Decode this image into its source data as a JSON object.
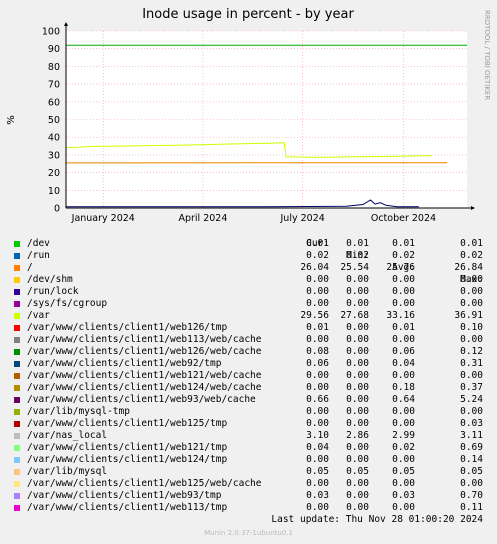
{
  "header": {
    "title": "Inode usage in percent - by year",
    "side_label": "RRDTOOL / TOBI OETIKER"
  },
  "chart_data": {
    "type": "line",
    "title": "Inode usage in percent - by year",
    "ylabel": "%",
    "ylim": [
      0,
      100
    ],
    "yticks": [
      0,
      10,
      20,
      30,
      40,
      50,
      60,
      70,
      80,
      90,
      100
    ],
    "xlim": [
      "2023-11-28",
      "2024-11-28"
    ],
    "xticks": [
      {
        "date": "2024-01-01",
        "label": "January 2024"
      },
      {
        "date": "2024-04-01",
        "label": "April 2024"
      },
      {
        "date": "2024-07-01",
        "label": "July 2024"
      },
      {
        "date": "2024-10-01",
        "label": "October 2024"
      }
    ],
    "grid": true,
    "series": [
      {
        "name": "/",
        "color": "#e88000",
        "points": [
          [
            "2023-11-28",
            25.5
          ],
          [
            "2024-11-10",
            25.6
          ]
        ]
      },
      {
        "name": "/var/nas_local",
        "color": "#00aa00",
        "points": [
          [
            "2023-11-28",
            92
          ],
          [
            "2024-11-28",
            92
          ]
        ]
      },
      {
        "name": "/var",
        "color": "#ccff00",
        "points": [
          [
            "2023-11-28",
            34.2
          ],
          [
            "2023-12-10",
            34.3
          ],
          [
            "2023-12-20",
            34.8
          ],
          [
            "2024-01-15",
            35.0
          ],
          [
            "2024-02-15",
            35.3
          ],
          [
            "2024-03-10",
            35.5
          ],
          [
            "2024-04-01",
            35.8
          ],
          [
            "2024-05-01",
            36.2
          ],
          [
            "2024-06-01",
            36.6
          ],
          [
            "2024-06-14",
            36.9
          ],
          [
            "2024-06-16",
            29.0
          ],
          [
            "2024-07-15",
            28.6
          ],
          [
            "2024-08-15",
            28.9
          ],
          [
            "2024-09-15",
            29.1
          ],
          [
            "2024-10-20",
            29.5
          ],
          [
            "2024-10-27",
            29.6
          ]
        ]
      },
      {
        "name": "/var/www/clients/client1/web93/web/cache",
        "color": "#000066",
        "points": [
          [
            "2023-11-28",
            0.7
          ],
          [
            "2024-06-01",
            0.7
          ],
          [
            "2024-08-10",
            1.0
          ],
          [
            "2024-08-25",
            2.0
          ],
          [
            "2024-09-01",
            4.5
          ],
          [
            "2024-09-05",
            2.2
          ],
          [
            "2024-09-10",
            3.0
          ],
          [
            "2024-09-15",
            1.5
          ],
          [
            "2024-09-25",
            0.7
          ],
          [
            "2024-10-15",
            0.7
          ]
        ]
      }
    ]
  },
  "legend": {
    "headers": {
      "cur": "Cur:",
      "min": "Min:",
      "avg": "Avg:",
      "max": "Max:"
    },
    "rows": [
      {
        "name": "/dev",
        "color": "#00cc00",
        "cur": "0.01",
        "min": "0.01",
        "avg": "0.01",
        "max": "0.01"
      },
      {
        "name": "/run",
        "color": "#0066b3",
        "cur": "0.02",
        "min": "0.02",
        "avg": "0.02",
        "max": "0.02"
      },
      {
        "name": "/",
        "color": "#ff8000",
        "cur": "26.04",
        "min": "25.54",
        "avg": "25.76",
        "max": "26.84"
      },
      {
        "name": "/dev/shm",
        "color": "#ffcc00",
        "cur": "0.00",
        "min": "0.00",
        "avg": "0.00",
        "max": "0.00"
      },
      {
        "name": "/run/lock",
        "color": "#330099",
        "cur": "0.00",
        "min": "0.00",
        "avg": "0.00",
        "max": "0.00"
      },
      {
        "name": "/sys/fs/cgroup",
        "color": "#990099",
        "cur": "0.00",
        "min": "0.00",
        "avg": "0.00",
        "max": "0.00"
      },
      {
        "name": "/var",
        "color": "#ccff00",
        "cur": "29.56",
        "min": "27.68",
        "avg": "33.16",
        "max": "36.91"
      },
      {
        "name": "/var/www/clients/client1/web126/tmp",
        "color": "#ff0000",
        "cur": "0.01",
        "min": "0.00",
        "avg": "0.01",
        "max": "0.10"
      },
      {
        "name": "/var/www/clients/client1/web113/web/cache",
        "color": "#808080",
        "cur": "0.00",
        "min": "0.00",
        "avg": "0.00",
        "max": "0.00"
      },
      {
        "name": "/var/www/clients/client1/web126/web/cache",
        "color": "#008f00",
        "cur": "0.08",
        "min": "0.00",
        "avg": "0.06",
        "max": "0.12"
      },
      {
        "name": "/var/www/clients/client1/web92/tmp",
        "color": "#00487d",
        "cur": "0.06",
        "min": "0.00",
        "avg": "0.04",
        "max": "0.31"
      },
      {
        "name": "/var/www/clients/client1/web121/web/cache",
        "color": "#b35a00",
        "cur": "0.00",
        "min": "0.00",
        "avg": "0.00",
        "max": "0.00"
      },
      {
        "name": "/var/www/clients/client1/web124/web/cache",
        "color": "#b38f00",
        "cur": "0.00",
        "min": "0.00",
        "avg": "0.18",
        "max": "0.37"
      },
      {
        "name": "/var/www/clients/client1/web93/web/cache",
        "color": "#6b006b",
        "cur": "0.66",
        "min": "0.00",
        "avg": "0.64",
        "max": "5.24"
      },
      {
        "name": "/var/lib/mysql-tmp",
        "color": "#8fb300",
        "cur": "0.00",
        "min": "0.00",
        "avg": "0.00",
        "max": "0.00"
      },
      {
        "name": "/var/www/clients/client1/web125/tmp",
        "color": "#b30000",
        "cur": "0.00",
        "min": "0.00",
        "avg": "0.00",
        "max": "0.03"
      },
      {
        "name": "/var/nas_local",
        "color": "#bebebe",
        "cur": "3.10",
        "min": "2.86",
        "avg": "2.99",
        "max": "3.11"
      },
      {
        "name": "/var/www/clients/client1/web121/tmp",
        "color": "#80ff80",
        "cur": "0.04",
        "min": "0.00",
        "avg": "0.02",
        "max": "0.69"
      },
      {
        "name": "/var/www/clients/client1/web124/tmp",
        "color": "#80c9ff",
        "cur": "0.00",
        "min": "0.00",
        "avg": "0.00",
        "max": "0.14"
      },
      {
        "name": "/var/lib/mysql",
        "color": "#ffc080",
        "cur": "0.05",
        "min": "0.05",
        "avg": "0.05",
        "max": "0.05"
      },
      {
        "name": "/var/www/clients/client1/web125/web/cache",
        "color": "#ffe680",
        "cur": "0.00",
        "min": "0.00",
        "avg": "0.00",
        "max": "0.00"
      },
      {
        "name": "/var/www/clients/client1/web93/tmp",
        "color": "#aa80ff",
        "cur": "0.03",
        "min": "0.00",
        "avg": "0.03",
        "max": "0.70"
      },
      {
        "name": "/var/www/clients/client1/web113/tmp",
        "color": "#ee00cc",
        "cur": "0.00",
        "min": "0.00",
        "avg": "0.00",
        "max": "0.11"
      }
    ]
  },
  "footer": {
    "last_update": "Last update: Thu Nov 28 01:00:20 2024",
    "munin": "Munin 2.0.37-1ubuntu0.1"
  }
}
